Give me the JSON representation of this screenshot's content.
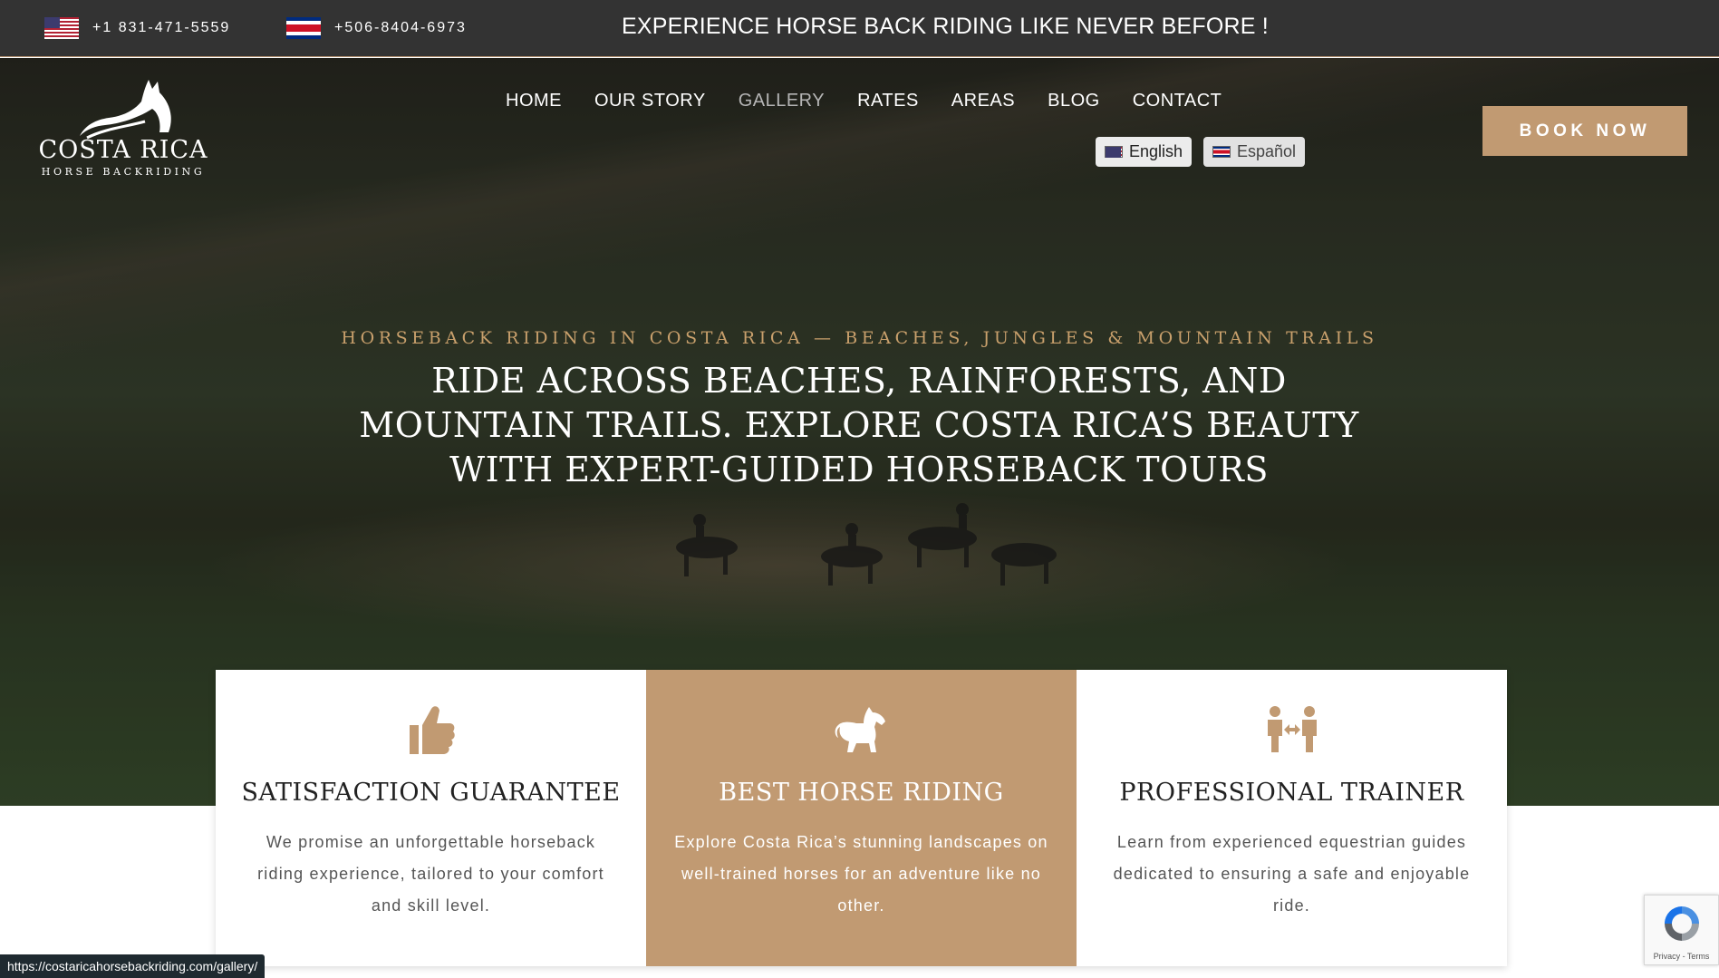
{
  "topbar": {
    "phone_us": "+1 831-471-5559",
    "phone_cr": "+506-8404-6973",
    "promo": "EXPERIENCE HORSE BACK RIDING LIKE NEVER BEFORE !"
  },
  "logo": {
    "title": "COSTA RICA",
    "subtitle": "HORSE BACKRIDING"
  },
  "nav": {
    "items": [
      {
        "label": "HOME"
      },
      {
        "label": "OUR STORY"
      },
      {
        "label": "GALLERY"
      },
      {
        "label": "RATES"
      },
      {
        "label": "AREAS"
      },
      {
        "label": "BLOG"
      },
      {
        "label": "CONTACT"
      }
    ],
    "active": "GALLERY"
  },
  "languages": {
    "english": "English",
    "spanish": "Español"
  },
  "book_button": "BOOK NOW",
  "hero": {
    "eyebrow": "HORSEBACK RIDING IN COSTA RICA — BEACHES, JUNGLES & MOUNTAIN TRAILS",
    "headline": "RIDE ACROSS BEACHES, RAINFORESTS, AND MOUNTAIN TRAILS. EXPLORE COSTA RICA’S BEAUTY WITH EXPERT-GUIDED HORSEBACK TOURS"
  },
  "features": [
    {
      "icon": "thumbs-up-icon",
      "title": "SATISFACTION GUARANTEE",
      "text": "We promise an unforgettable horseback riding experience, tailored to your comfort and skill level."
    },
    {
      "icon": "horse-icon",
      "title": "BEST HORSE RIDING",
      "text": "Explore Costa Rica’s stunning landscapes on well-trained horses for an adventure like no other."
    },
    {
      "icon": "trainer-icon",
      "title": "PROFESSIONAL TRAINER",
      "text": "Learn from experienced equestrian guides dedicated to ensuring a safe and enjoyable ride."
    }
  ],
  "status_url": "https://costaricahorsebackriding.com/gallery/",
  "recaptcha": {
    "text": "Privacy - Terms"
  },
  "colors": {
    "accent": "#c19a72",
    "eyebrow": "#c9a06c",
    "topbar": "#333333"
  }
}
